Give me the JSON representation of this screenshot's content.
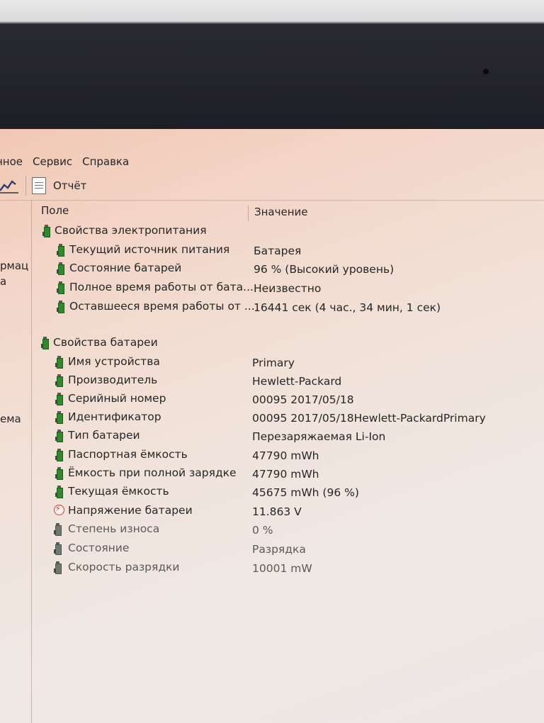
{
  "menu": {
    "items": [
      "нное",
      "Сервис",
      "Справка"
    ]
  },
  "toolbar": {
    "report_label": "Отчёт"
  },
  "left_pane": {
    "fragments": [
      "рмац",
      "а",
      "ема"
    ]
  },
  "table": {
    "col_field": "Поле",
    "col_value": "Значение",
    "groups": [
      {
        "title": "Свойства электропитания",
        "rows": [
          {
            "field": "Текущий источник питания",
            "value": "Батарея"
          },
          {
            "field": "Состояние батарей",
            "value": "96 % (Высокий уровень)"
          },
          {
            "field": "Полное время работы от бата...",
            "value": "Неизвестно"
          },
          {
            "field": "Оставшееся время работы от ...",
            "value": "16441 сек (4 час., 34 мин, 1 сек)"
          }
        ]
      },
      {
        "title": "Свойства батареи",
        "rows": [
          {
            "field": "Имя устройства",
            "value": "Primary"
          },
          {
            "field": "Производитель",
            "value": "Hewlett-Packard"
          },
          {
            "field": "Серийный номер",
            "value": "00095 2017/05/18"
          },
          {
            "field": "Идентификатор",
            "value": "00095 2017/05/18Hewlett-PackardPrimary"
          },
          {
            "field": "Тип батареи",
            "value": "Перезаряжаемая Li-Ion"
          },
          {
            "field": "Паспортная ёмкость",
            "value": "47790 mWh"
          },
          {
            "field": "Ёмкость при полной зарядке",
            "value": "47790 mWh"
          },
          {
            "field": "Текущая ёмкость",
            "value": "45675 mWh  (96 %)"
          },
          {
            "field": "Напряжение батареи",
            "value": "11.863 V",
            "icon": "voltage-icon"
          },
          {
            "field": "Степень износа",
            "value": "0 %"
          },
          {
            "field": "Состояние",
            "value": "Разрядка"
          },
          {
            "field": "Скорость разрядки",
            "value": "10001 mW"
          }
        ]
      }
    ]
  }
}
